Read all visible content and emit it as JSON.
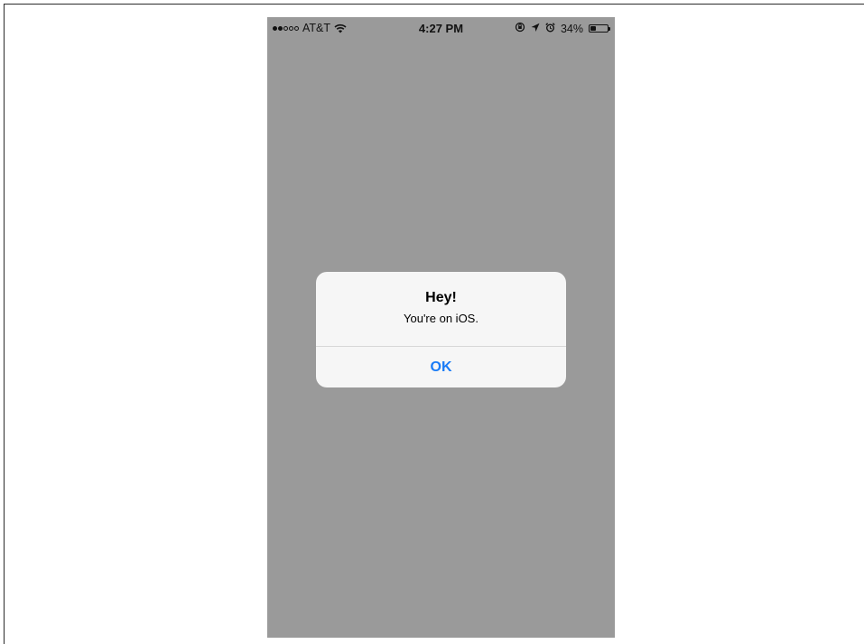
{
  "status_bar": {
    "carrier": "AT&T",
    "signal_bars_filled": 2,
    "signal_bars_total": 5,
    "time": "4:27 PM",
    "battery_percent": "34%",
    "battery_level": 0.34,
    "icons": [
      "wifi-icon",
      "rotation-lock-icon",
      "location-arrow-icon",
      "alarm-icon",
      "battery-icon"
    ]
  },
  "alert": {
    "title": "Hey!",
    "message": "You're on iOS.",
    "button_label": "OK"
  },
  "colors": {
    "overlay": "#9a9a9a",
    "alert_background": "#f6f6f6",
    "button_text": "#1a7cf6"
  }
}
